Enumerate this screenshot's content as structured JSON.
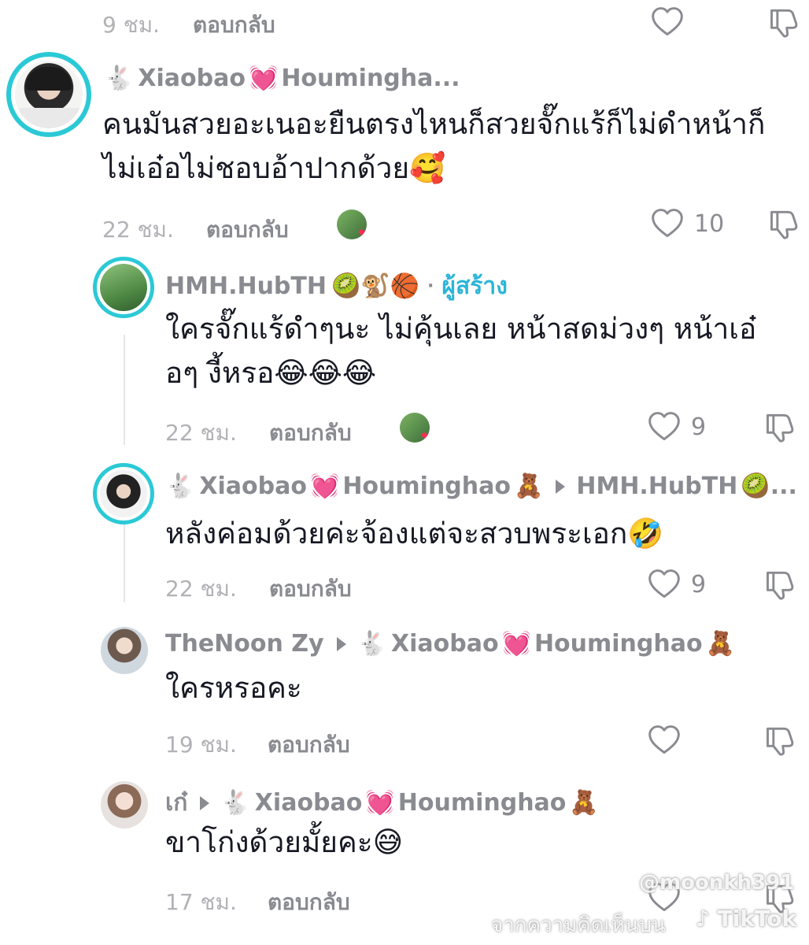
{
  "comments": [
    {
      "id": "top",
      "time": "9 ชม.",
      "reply": "ตอบกลับ",
      "likes": ""
    },
    {
      "id": "c1",
      "username_a": "Xiaobao",
      "username_b": "Houmingha...",
      "text_l1": "คนมันสวยอะเนอะยืนตรงไหนก็สวยจั๊กแร้ก็ไม่ดำหน้าก็",
      "text_l2": "ไม่เอ๋อไม่ชอบอ้าปากด้วย🥰",
      "time": "22 ชม.",
      "reply": "ตอบกลับ",
      "likes": "10"
    },
    {
      "id": "c2",
      "username": "HMH.HubTH",
      "emojis": "🥝🐒🏀",
      "dot": "·",
      "creator": "ผู้สร้าง",
      "text_l1": "ใครจั๊กแร้ดำๆนะ ไม่คุ้นเลย หน้าสดม่วงๆ หน้าเอ๋",
      "text_l2": "อๆ งี้หรอ😂😂😂",
      "time": "22 ชม.",
      "reply": "ตอบกลับ",
      "likes": "9"
    },
    {
      "id": "c3",
      "username_a": "Xiaobao",
      "username_b": "Houminghao",
      "reply_to": "HMH.HubTH",
      "text_l1": "หลังค่อมด้วยค่ะจ้องแต่จะสวบพระเอก🤣",
      "time": "22 ชม.",
      "reply": "ตอบกลับ",
      "likes": "9"
    },
    {
      "id": "c4",
      "username": "TheNoon Zy",
      "reply_to_a": "Xiaobao",
      "reply_to_b": "Houminghao",
      "text_l1": "ใครหรอคะ",
      "time": "19 ชม.",
      "reply": "ตอบกลับ",
      "likes": ""
    },
    {
      "id": "c5",
      "username": "เก๋",
      "reply_to_a": "Xiaobao",
      "reply_to_b": "Houminghao",
      "text_l1": "ขาโก่งด้วยมั้ยคะ😅",
      "time": "17 ชม.",
      "reply": "ตอบกลับ",
      "likes": ""
    }
  ],
  "watermark": {
    "handle": "@moonkh391",
    "caption": "จากความคิดเห็นบน",
    "brand": "TikTok"
  },
  "colors": {
    "creator": "#2bb5d8",
    "ring": "#2bc9d6",
    "muted": "#8a8b91",
    "time": "#b1b1b6"
  }
}
